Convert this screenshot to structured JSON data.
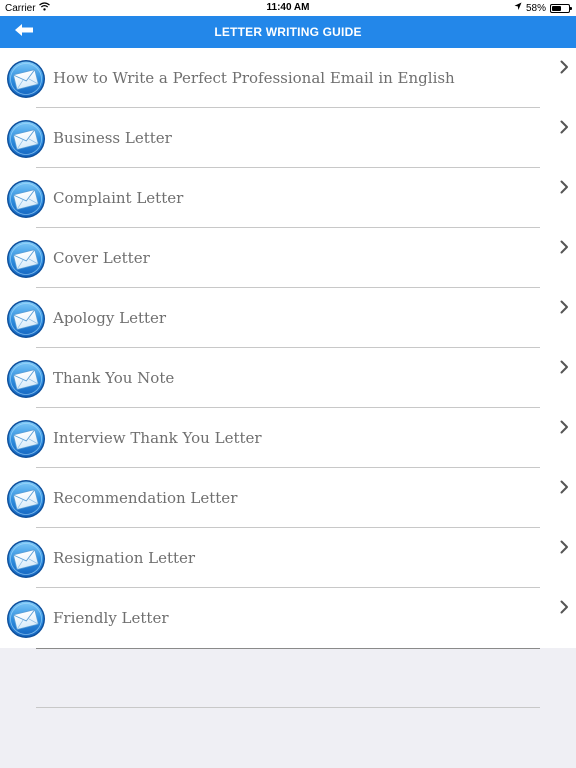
{
  "status_bar": {
    "carrier": "Carrier",
    "time": "11:40 AM",
    "battery": "58%",
    "battery_level": 0.58
  },
  "header": {
    "title": "LETTER WRITING GUIDE",
    "background_color": "#2387e9",
    "back_icon": "arrow-left-icon"
  },
  "list": {
    "item_icon": "envelope-icon",
    "chevron_icon": "chevron-right-icon",
    "items": [
      {
        "label": "How to Write a Perfect Professional Email in English"
      },
      {
        "label": "Business Letter"
      },
      {
        "label": "Complaint Letter"
      },
      {
        "label": "Cover Letter"
      },
      {
        "label": "Apology Letter"
      },
      {
        "label": "Thank You Note"
      },
      {
        "label": "Interview Thank You Letter"
      },
      {
        "label": "Recommendation Letter"
      },
      {
        "label": "Resignation Letter"
      },
      {
        "label": "Friendly Letter"
      }
    ]
  }
}
